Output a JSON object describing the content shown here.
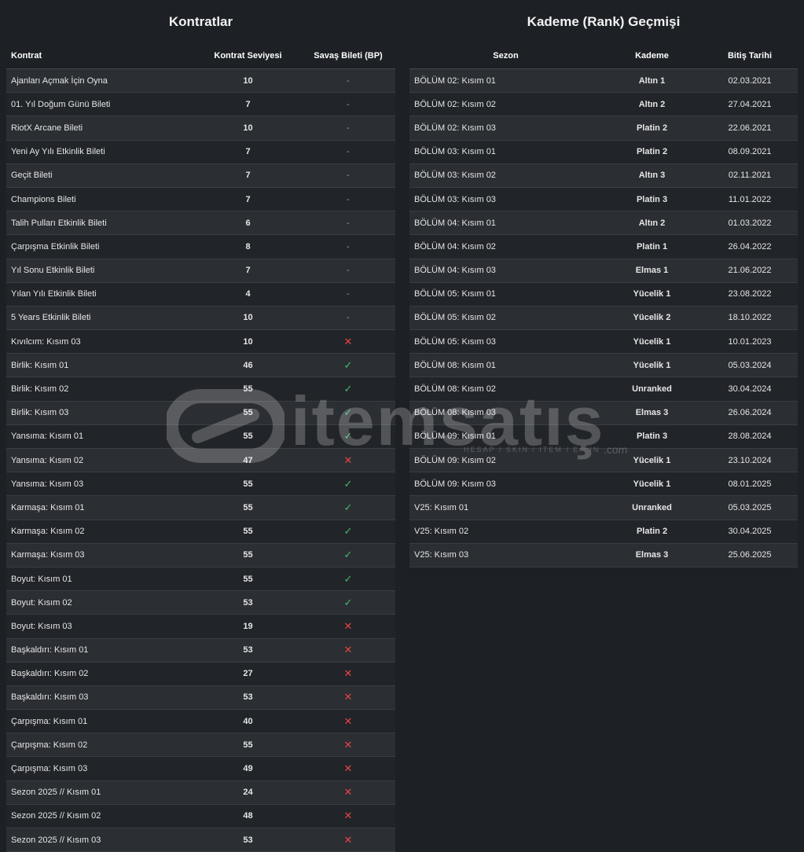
{
  "contracts": {
    "title": "Kontratlar",
    "headers": [
      "Kontrat",
      "Kontrat Seviyesi",
      "Savaş Bileti (BP)"
    ],
    "rows": [
      {
        "name": "Ajanları Açmak İçin Oyna",
        "level": "10",
        "bp": "-"
      },
      {
        "name": "01. Yıl Doğum Günü Bileti",
        "level": "7",
        "bp": "-"
      },
      {
        "name": "RiotX Arcane Bileti",
        "level": "10",
        "bp": "-"
      },
      {
        "name": "Yeni Ay Yılı Etkinlik Bileti",
        "level": "7",
        "bp": "-"
      },
      {
        "name": "Geçit Bileti",
        "level": "7",
        "bp": "-"
      },
      {
        "name": "Champions Bileti",
        "level": "7",
        "bp": "-"
      },
      {
        "name": "Talih Pulları Etkinlik Bileti",
        "level": "6",
        "bp": "-"
      },
      {
        "name": "Çarpışma Etkinlik Bileti",
        "level": "8",
        "bp": "-"
      },
      {
        "name": "Yıl Sonu Etkinlik Bileti",
        "level": "7",
        "bp": "-"
      },
      {
        "name": "Yılan Yılı Etkinlik Bileti",
        "level": "4",
        "bp": "-"
      },
      {
        "name": "5 Years Etkinlik Bileti",
        "level": "10",
        "bp": "-"
      },
      {
        "name": "Kıvılcım: Kısım 03",
        "level": "10",
        "bp": "✕"
      },
      {
        "name": "Birlik: Kısım 01",
        "level": "46",
        "bp": "✓"
      },
      {
        "name": "Birlik: Kısım 02",
        "level": "55",
        "bp": "✓"
      },
      {
        "name": "Birlik: Kısım 03",
        "level": "55",
        "bp": "✓"
      },
      {
        "name": "Yansıma: Kısım 01",
        "level": "55",
        "bp": "✓"
      },
      {
        "name": "Yansıma: Kısım 02",
        "level": "47",
        "bp": "✕"
      },
      {
        "name": "Yansıma: Kısım 03",
        "level": "55",
        "bp": "✓"
      },
      {
        "name": "Karmaşa: Kısım 01",
        "level": "55",
        "bp": "✓"
      },
      {
        "name": "Karmaşa: Kısım 02",
        "level": "55",
        "bp": "✓"
      },
      {
        "name": "Karmaşa: Kısım 03",
        "level": "55",
        "bp": "✓"
      },
      {
        "name": "Boyut: Kısım 01",
        "level": "55",
        "bp": "✓"
      },
      {
        "name": "Boyut: Kısım 02",
        "level": "53",
        "bp": "✓"
      },
      {
        "name": "Boyut: Kısım 03",
        "level": "19",
        "bp": "✕"
      },
      {
        "name": "Başkaldırı: Kısım 01",
        "level": "53",
        "bp": "✕"
      },
      {
        "name": "Başkaldırı: Kısım 02",
        "level": "27",
        "bp": "✕"
      },
      {
        "name": "Başkaldırı: Kısım 03",
        "level": "53",
        "bp": "✕"
      },
      {
        "name": "Çarpışma: Kısım 01",
        "level": "40",
        "bp": "✕"
      },
      {
        "name": "Çarpışma: Kısım 02",
        "level": "55",
        "bp": "✕"
      },
      {
        "name": "Çarpışma: Kısım 03",
        "level": "49",
        "bp": "✕"
      },
      {
        "name": "Sezon 2025 // Kısım 01",
        "level": "24",
        "bp": "✕"
      },
      {
        "name": "Sezon 2025 // Kısım 02",
        "level": "48",
        "bp": "✕"
      },
      {
        "name": "Sezon 2025 // Kısım 03",
        "level": "53",
        "bp": "✕"
      }
    ]
  },
  "ranks": {
    "title": "Kademe (Rank) Geçmişi",
    "headers": [
      "Sezon",
      "Kademe",
      "Bitiş Tarihi"
    ],
    "rows": [
      {
        "season": "BÖLÜM 02: Kısım 01",
        "rank": "Altın 1",
        "end": "02.03.2021"
      },
      {
        "season": "BÖLÜM 02: Kısım 02",
        "rank": "Altın 2",
        "end": "27.04.2021"
      },
      {
        "season": "BÖLÜM 02: Kısım 03",
        "rank": "Platin 2",
        "end": "22.06.2021"
      },
      {
        "season": "BÖLÜM 03: Kısım 01",
        "rank": "Platin 2",
        "end": "08.09.2021"
      },
      {
        "season": "BÖLÜM 03: Kısım 02",
        "rank": "Altın 3",
        "end": "02.11.2021"
      },
      {
        "season": "BÖLÜM 03: Kısım 03",
        "rank": "Platin 3",
        "end": "11.01.2022"
      },
      {
        "season": "BÖLÜM 04: Kısım 01",
        "rank": "Altın 2",
        "end": "01.03.2022"
      },
      {
        "season": "BÖLÜM 04: Kısım 02",
        "rank": "Platin 1",
        "end": "26.04.2022"
      },
      {
        "season": "BÖLÜM 04: Kısım 03",
        "rank": "Elmas 1",
        "end": "21.06.2022"
      },
      {
        "season": "BÖLÜM 05: Kısım 01",
        "rank": "Yücelik 1",
        "end": "23.08.2022"
      },
      {
        "season": "BÖLÜM 05: Kısım 02",
        "rank": "Yücelik 2",
        "end": "18.10.2022"
      },
      {
        "season": "BÖLÜM 05: Kısım 03",
        "rank": "Yücelik 1",
        "end": "10.01.2023"
      },
      {
        "season": "BÖLÜM 08: Kısım 01",
        "rank": "Yücelik 1",
        "end": "05.03.2024"
      },
      {
        "season": "BÖLÜM 08: Kısım 02",
        "rank": "Unranked",
        "end": "30.04.2024"
      },
      {
        "season": "BÖLÜM 08: Kısım 03",
        "rank": "Elmas 3",
        "end": "26.06.2024"
      },
      {
        "season": "BÖLÜM 09: Kısım 01",
        "rank": "Platin 3",
        "end": "28.08.2024"
      },
      {
        "season": "BÖLÜM 09: Kısım 02",
        "rank": "Yücelik 1",
        "end": "23.10.2024"
      },
      {
        "season": "BÖLÜM 09: Kısım 03",
        "rank": "Yücelik 1",
        "end": "08.01.2025"
      },
      {
        "season": "V25: Kısım 01",
        "rank": "Unranked",
        "end": "05.03.2025"
      },
      {
        "season": "V25: Kısım 02",
        "rank": "Platin 2",
        "end": "30.04.2025"
      },
      {
        "season": "V25: Kısım 03",
        "rank": "Elmas 3",
        "end": "25.06.2025"
      }
    ]
  },
  "watermark": {
    "brand": "itemsatış",
    "tagline": "HESAP / SKIN / ITEM / E-PIN",
    "suffix": ".com"
  },
  "colors": {
    "background": "#1d2024",
    "check": "#3fbf6a",
    "cross": "#e64545"
  },
  "icons": {
    "check": "check-icon",
    "cross": "cross-icon",
    "logo": "itemsatis-logo-icon"
  }
}
